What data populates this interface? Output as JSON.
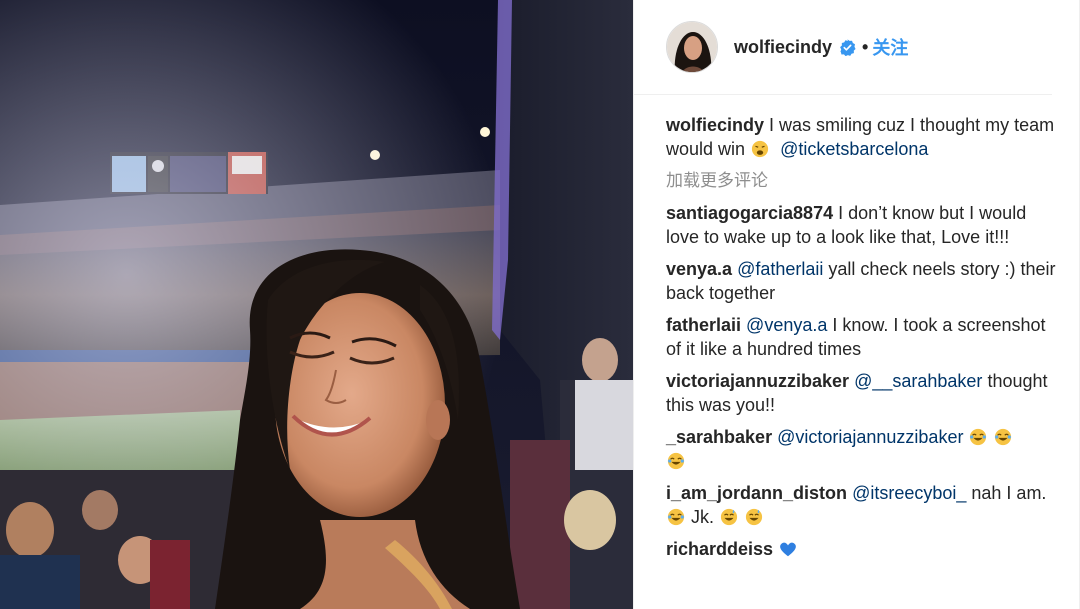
{
  "post": {
    "username": "wolfiecindy",
    "follow_label": "关注",
    "separator": "•",
    "caption": {
      "username": "wolfiecindy",
      "text_before": " I was smiling cuz I thought my team would win ",
      "emoji": "weary-face",
      "mention": "@ticketsbarcelona"
    },
    "load_more": "加载更多评论"
  },
  "comments": [
    {
      "username": "santiagogarcia8874",
      "text": " I don’t know but I would love to wake up to a look like that, Love it!!!"
    },
    {
      "username": "venya.a",
      "mention": "@fatherlaii",
      "text": " yall check neels story :) their back together"
    },
    {
      "username": "fatherlaii",
      "mention": "@venya.a",
      "text": " I know. I took a screenshot of it like a hundred times"
    },
    {
      "username": "victoriajannuzzibaker",
      "mention": "@__sarahbaker",
      "text": " thought this was you!!"
    },
    {
      "username": "_sarahbaker",
      "mention": "@victoriajannuzzibaker",
      "emojis": [
        "joy",
        "joy",
        "joy"
      ]
    },
    {
      "username": "i_am_jordann_diston",
      "mention": "@itsreecyboi_",
      "text": " nah I am. ",
      "emoji1": "joy",
      "text2": "  Jk. ",
      "emojis2": [
        "sweat-smile",
        "sweat-smile"
      ]
    },
    {
      "username": "richarddeiss",
      "emoji": "blue-heart"
    }
  ],
  "colors": {
    "link": "#003569",
    "follow": "#3897f0",
    "muted": "#8e8e8e",
    "text": "#262626"
  }
}
